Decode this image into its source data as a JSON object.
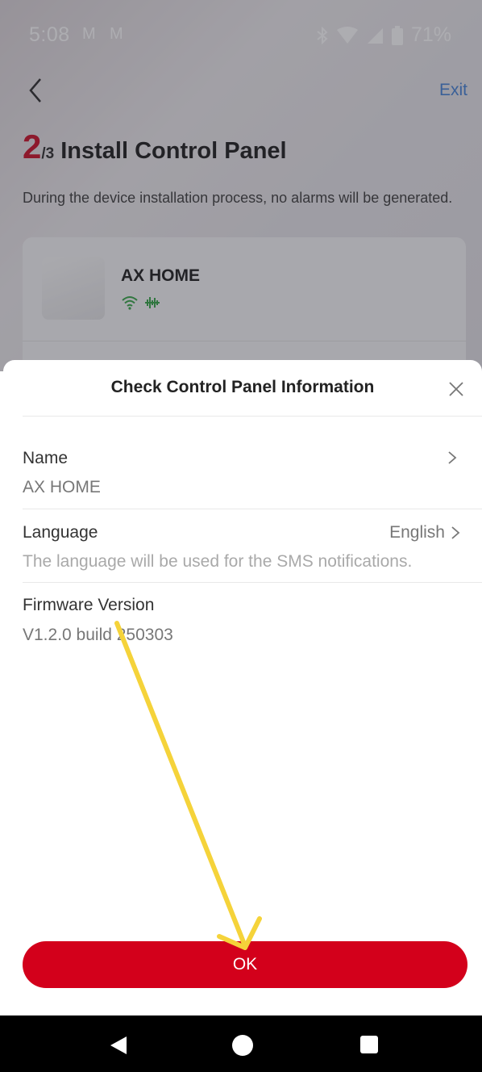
{
  "status_bar": {
    "time": "5:08",
    "mail_icons": [
      "M",
      "M"
    ],
    "battery": "71%"
  },
  "header": {
    "exit_label": "Exit",
    "step_current": "2",
    "step_total": "/3",
    "title": "Install Control Panel",
    "description": "During the device installation process, no alarms will be generated."
  },
  "device": {
    "name": "AX HOME"
  },
  "sheet": {
    "title": "Check Control Panel Information",
    "rows": [
      {
        "label": "Name",
        "value": "AX HOME"
      },
      {
        "label": "Language",
        "right_value": "English",
        "hint": "The language will be used for the SMS notifications."
      },
      {
        "label": "Firmware Version",
        "value": "V1.2.0 build 250303"
      }
    ],
    "ok_label": "OK"
  },
  "colors": {
    "accent_red": "#d3001b",
    "link_blue": "#3a7bd5",
    "annotation_yellow": "#f5d33a"
  }
}
